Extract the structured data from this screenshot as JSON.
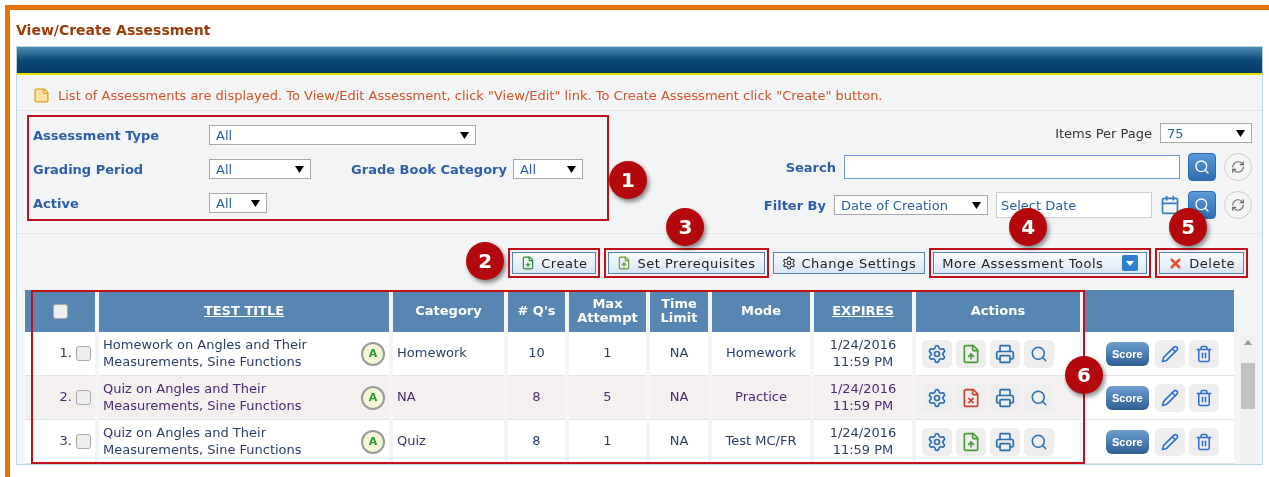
{
  "page_title": "View/Create Assessment",
  "info": "List of Assessments are displayed. To View/Edit Assessment, click \"View/Edit\" link. To Create Assessment click \"Create\" button.",
  "filters": {
    "assessment_type": {
      "label": "Assessment Type",
      "value": "All"
    },
    "grading_period": {
      "label": "Grading Period",
      "value": "All"
    },
    "grade_book_category": {
      "label": "Grade Book Category",
      "value": "All"
    },
    "active": {
      "label": "Active",
      "value": "All"
    },
    "items_per_page": {
      "label": "Items Per Page",
      "value": "75"
    },
    "search": {
      "label": "Search"
    },
    "filter_by": {
      "label": "Filter By",
      "value": "Date of Creation",
      "date_placeholder": "Select Date"
    }
  },
  "buttons": {
    "create": "Create",
    "set_prerequisites": "Set Prerequisites",
    "change_settings": "Change Settings",
    "more_tools": "More Assessment Tools",
    "delete": "Delete"
  },
  "callouts": [
    "1",
    "2",
    "3",
    "4",
    "5",
    "6"
  ],
  "table": {
    "select_all_checked": false,
    "columns": [
      "TEST TITLE",
      "Category",
      "# Q's",
      "Max Attempt",
      "Time Limit",
      "Mode",
      "EXPIRES",
      "Actions"
    ],
    "rows": [
      {
        "index": "1.",
        "checked": false,
        "title": "Homework on Angles and Their Measurements, Sine Functions",
        "badge": "A",
        "category": "Homework",
        "questions": "10",
        "max_attempt": "1",
        "time_limit": "NA",
        "mode": "Homework",
        "expires": "1/24/2016 11:59 PM",
        "published": true,
        "score": "Score"
      },
      {
        "index": "2.",
        "checked": false,
        "title": "Quiz on Angles and Their Measurements, Sine Functions",
        "badge": "A",
        "category": "NA",
        "questions": "8",
        "max_attempt": "5",
        "time_limit": "NA",
        "mode": "Practice",
        "expires": "1/24/2016 11:59 PM",
        "published": false,
        "score": "Score"
      },
      {
        "index": "3.",
        "checked": false,
        "title": "Quiz on Angles and Their Measurements, Sine Functions",
        "badge": "A",
        "category": "Quiz",
        "questions": "8",
        "max_attempt": "1",
        "time_limit": "NA",
        "mode": "Test MC/FR",
        "expires": "1/24/2016 11:59 PM",
        "published": true,
        "score": "Score"
      }
    ]
  }
}
